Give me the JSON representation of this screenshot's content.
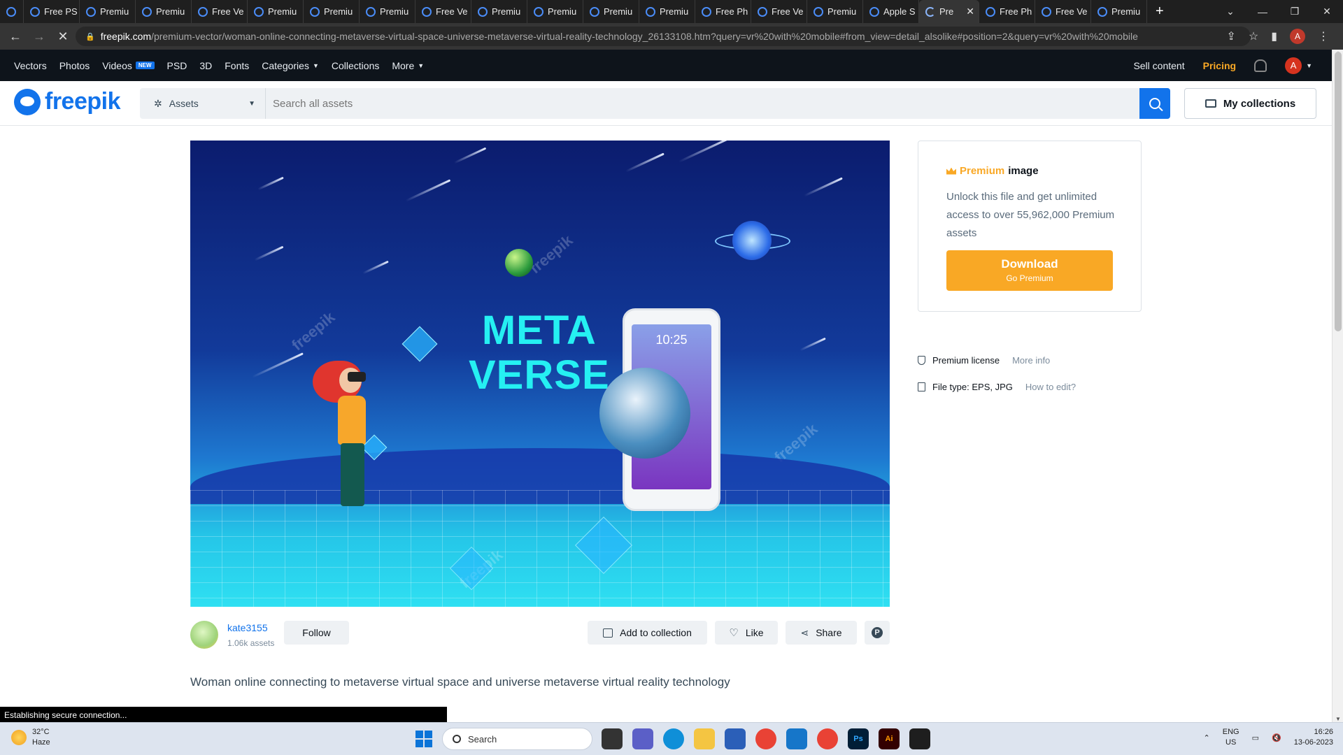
{
  "browser": {
    "tabs": [
      {
        "label": ""
      },
      {
        "label": "Free PS"
      },
      {
        "label": "Premiu"
      },
      {
        "label": "Premiu"
      },
      {
        "label": "Free Ve"
      },
      {
        "label": "Premiu"
      },
      {
        "label": "Premiu"
      },
      {
        "label": "Premiu"
      },
      {
        "label": "Free Ve"
      },
      {
        "label": "Premiu"
      },
      {
        "label": "Premiu"
      },
      {
        "label": "Premiu"
      },
      {
        "label": "Premiu"
      },
      {
        "label": "Free Ph"
      },
      {
        "label": "Free Ve"
      },
      {
        "label": "Premiu"
      },
      {
        "label": "Apple S"
      }
    ],
    "active_tab": {
      "label": "Pre",
      "close": "✕"
    },
    "tabs_after": [
      {
        "label": "Free Ph"
      },
      {
        "label": "Free Ve"
      },
      {
        "label": "Premiu"
      }
    ],
    "new_tab": "+",
    "url_domain": "freepik.com",
    "url_path": "/premium-vector/woman-online-connecting-metaverse-virtual-space-universe-metaverse-virtual-reality-technology_26133108.htm?query=vr%20with%20mobile#from_view=detail_alsolike#position=2&query=vr%20with%20mobile",
    "profile_initial": "A"
  },
  "menu": {
    "items": [
      "Vectors",
      "Photos",
      "Videos",
      "PSD",
      "3D",
      "Fonts",
      "Categories",
      "Collections",
      "More"
    ],
    "new_badge": "NEW",
    "sell": "Sell content",
    "pricing": "Pricing",
    "profile_initial": "A"
  },
  "header": {
    "logo": "freepik",
    "assets_label": "Assets",
    "search_placeholder": "Search all assets",
    "my_collections": "My collections"
  },
  "hero": {
    "title_line1": "META",
    "title_line2": "VERSE",
    "phone_time": "10:25",
    "watermark": "freepik"
  },
  "sidebar": {
    "premium_word": "Premium",
    "image_word": "image",
    "description": "Unlock this file and get unlimited access to over 55,962,000 Premium assets",
    "download": "Download",
    "go_premium": "Go Premium",
    "license": "Premium license",
    "license_more": "More info",
    "file_type": "File type: EPS, JPG",
    "file_type_more": "How to edit?"
  },
  "author": {
    "name": "kate3155",
    "count": "1.06k assets",
    "follow": "Follow"
  },
  "actions": {
    "add_to_collection": "Add to collection",
    "like": "Like",
    "share": "Share",
    "pinterest": "P"
  },
  "description": "Woman online connecting to metaverse virtual space and universe metaverse virtual reality technology",
  "status_bar": "Establishing secure connection...",
  "taskbar": {
    "temp": "32°C",
    "weather": "Haze",
    "search": "Search",
    "lang1": "ENG",
    "lang2": "US",
    "time": "16:26",
    "date": "13-06-2023"
  },
  "colors": {
    "brand_blue": "#1273eb",
    "premium_gold": "#f9a825",
    "nav_dark": "#0e141b"
  }
}
